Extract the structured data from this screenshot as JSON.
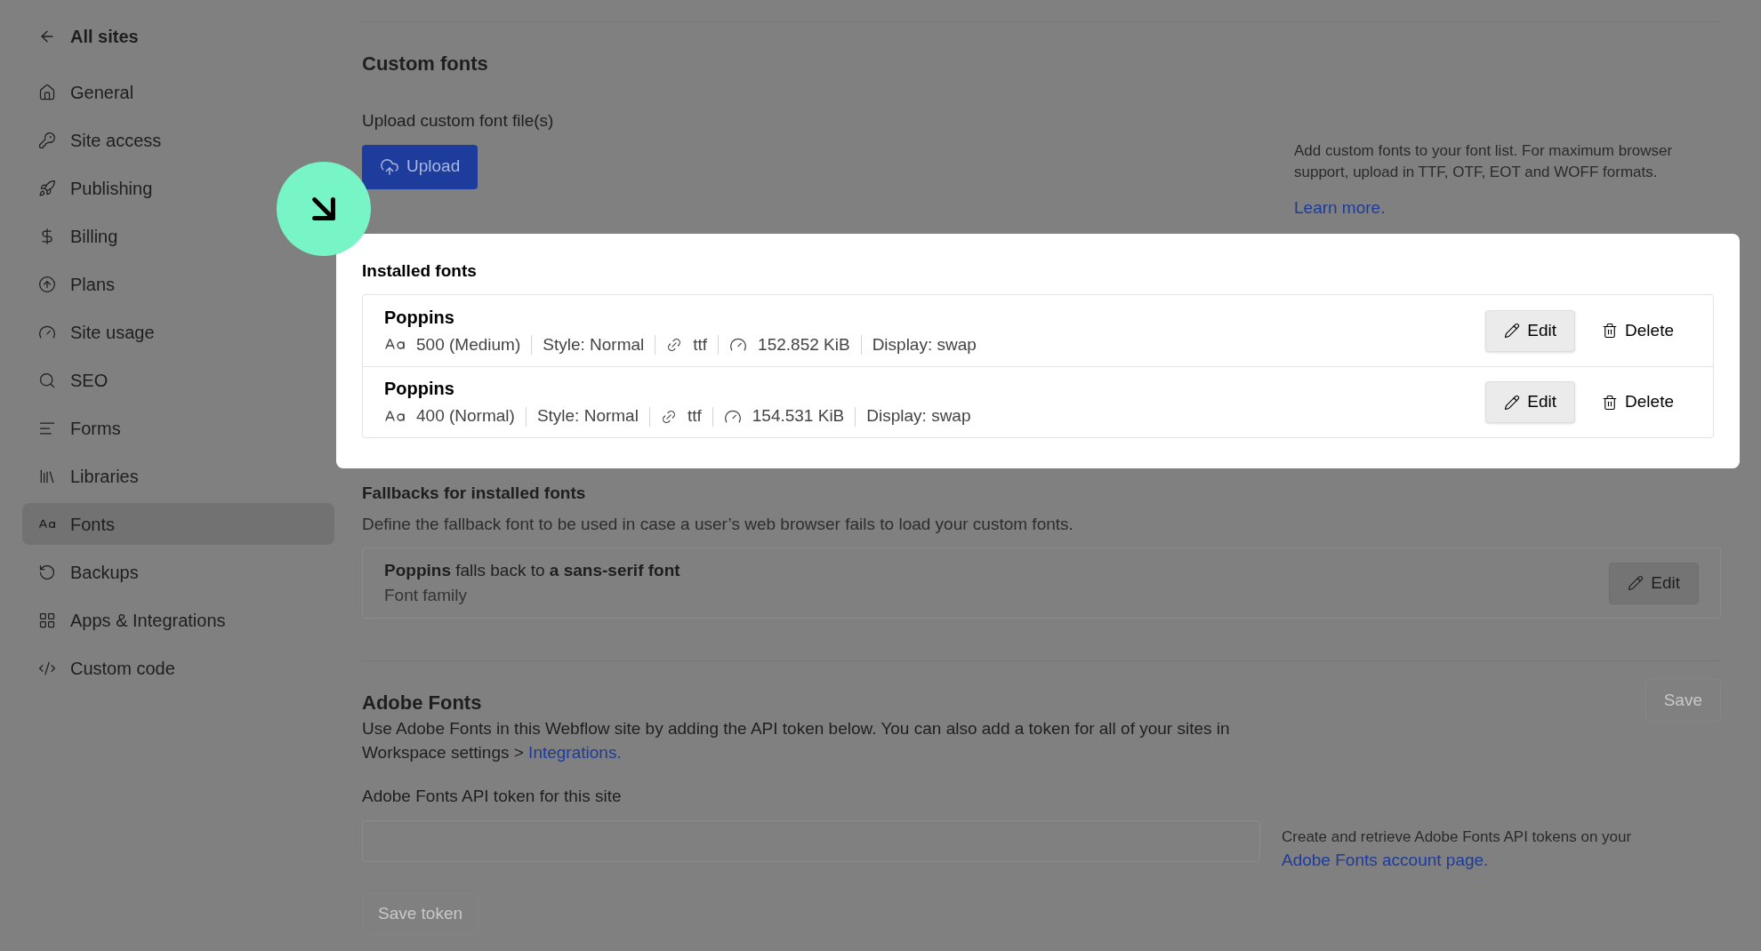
{
  "sidebar": {
    "back": "All sites",
    "items": [
      {
        "label": "General",
        "selected": false
      },
      {
        "label": "Site access",
        "selected": false
      },
      {
        "label": "Publishing",
        "selected": false
      },
      {
        "label": "Billing",
        "selected": false
      },
      {
        "label": "Plans",
        "selected": false
      },
      {
        "label": "Site usage",
        "selected": false
      },
      {
        "label": "SEO",
        "selected": false
      },
      {
        "label": "Forms",
        "selected": false
      },
      {
        "label": "Libraries",
        "selected": false
      },
      {
        "label": "Fonts",
        "selected": true
      },
      {
        "label": "Backups",
        "selected": false
      },
      {
        "label": "Apps & Integrations",
        "selected": false
      },
      {
        "label": "Custom code",
        "selected": false
      }
    ]
  },
  "custom_fonts": {
    "title": "Custom fonts",
    "upload_label": "Upload custom font file(s)",
    "upload_button": "Upload",
    "help": "Add custom fonts to your font list. For maximum browser support, upload in TTF, OTF, EOT and WOFF formats.",
    "learn_more": "Learn more."
  },
  "installed_fonts": {
    "title": "Installed fonts",
    "fonts": [
      {
        "name": "Poppins",
        "weight": "500 (Medium)",
        "style": "Style: Normal",
        "format": "ttf",
        "size": "152.852 KiB",
        "display": "Display: swap",
        "edit": "Edit",
        "delete": "Delete"
      },
      {
        "name": "Poppins",
        "weight": "400 (Normal)",
        "style": "Style: Normal",
        "format": "ttf",
        "size": "154.531 KiB",
        "display": "Display: swap",
        "edit": "Edit",
        "delete": "Delete"
      }
    ]
  },
  "fallbacks": {
    "title": "Fallbacks for installed fonts",
    "description": "Define the fallback font to be used in case a user’s web browser fails to load your custom fonts.",
    "rule": "**Poppins** falls back to **a sans-serif font**",
    "sub": "Font family",
    "edit": "Edit"
  },
  "adobe_fonts": {
    "title": "Adobe Fonts",
    "save": "Save",
    "description": "Use Adobe Fonts in this Webflow site by adding the API token below. You can also add a token for all of your sites in Workspace settings >",
    "link": "Integrations.",
    "token_label": "Adobe Fonts API token for this site",
    "help": "Create and retrieve Adobe Fonts API tokens on your",
    "help_link": "Adobe Fonts account page.",
    "save_token": "Save token"
  }
}
